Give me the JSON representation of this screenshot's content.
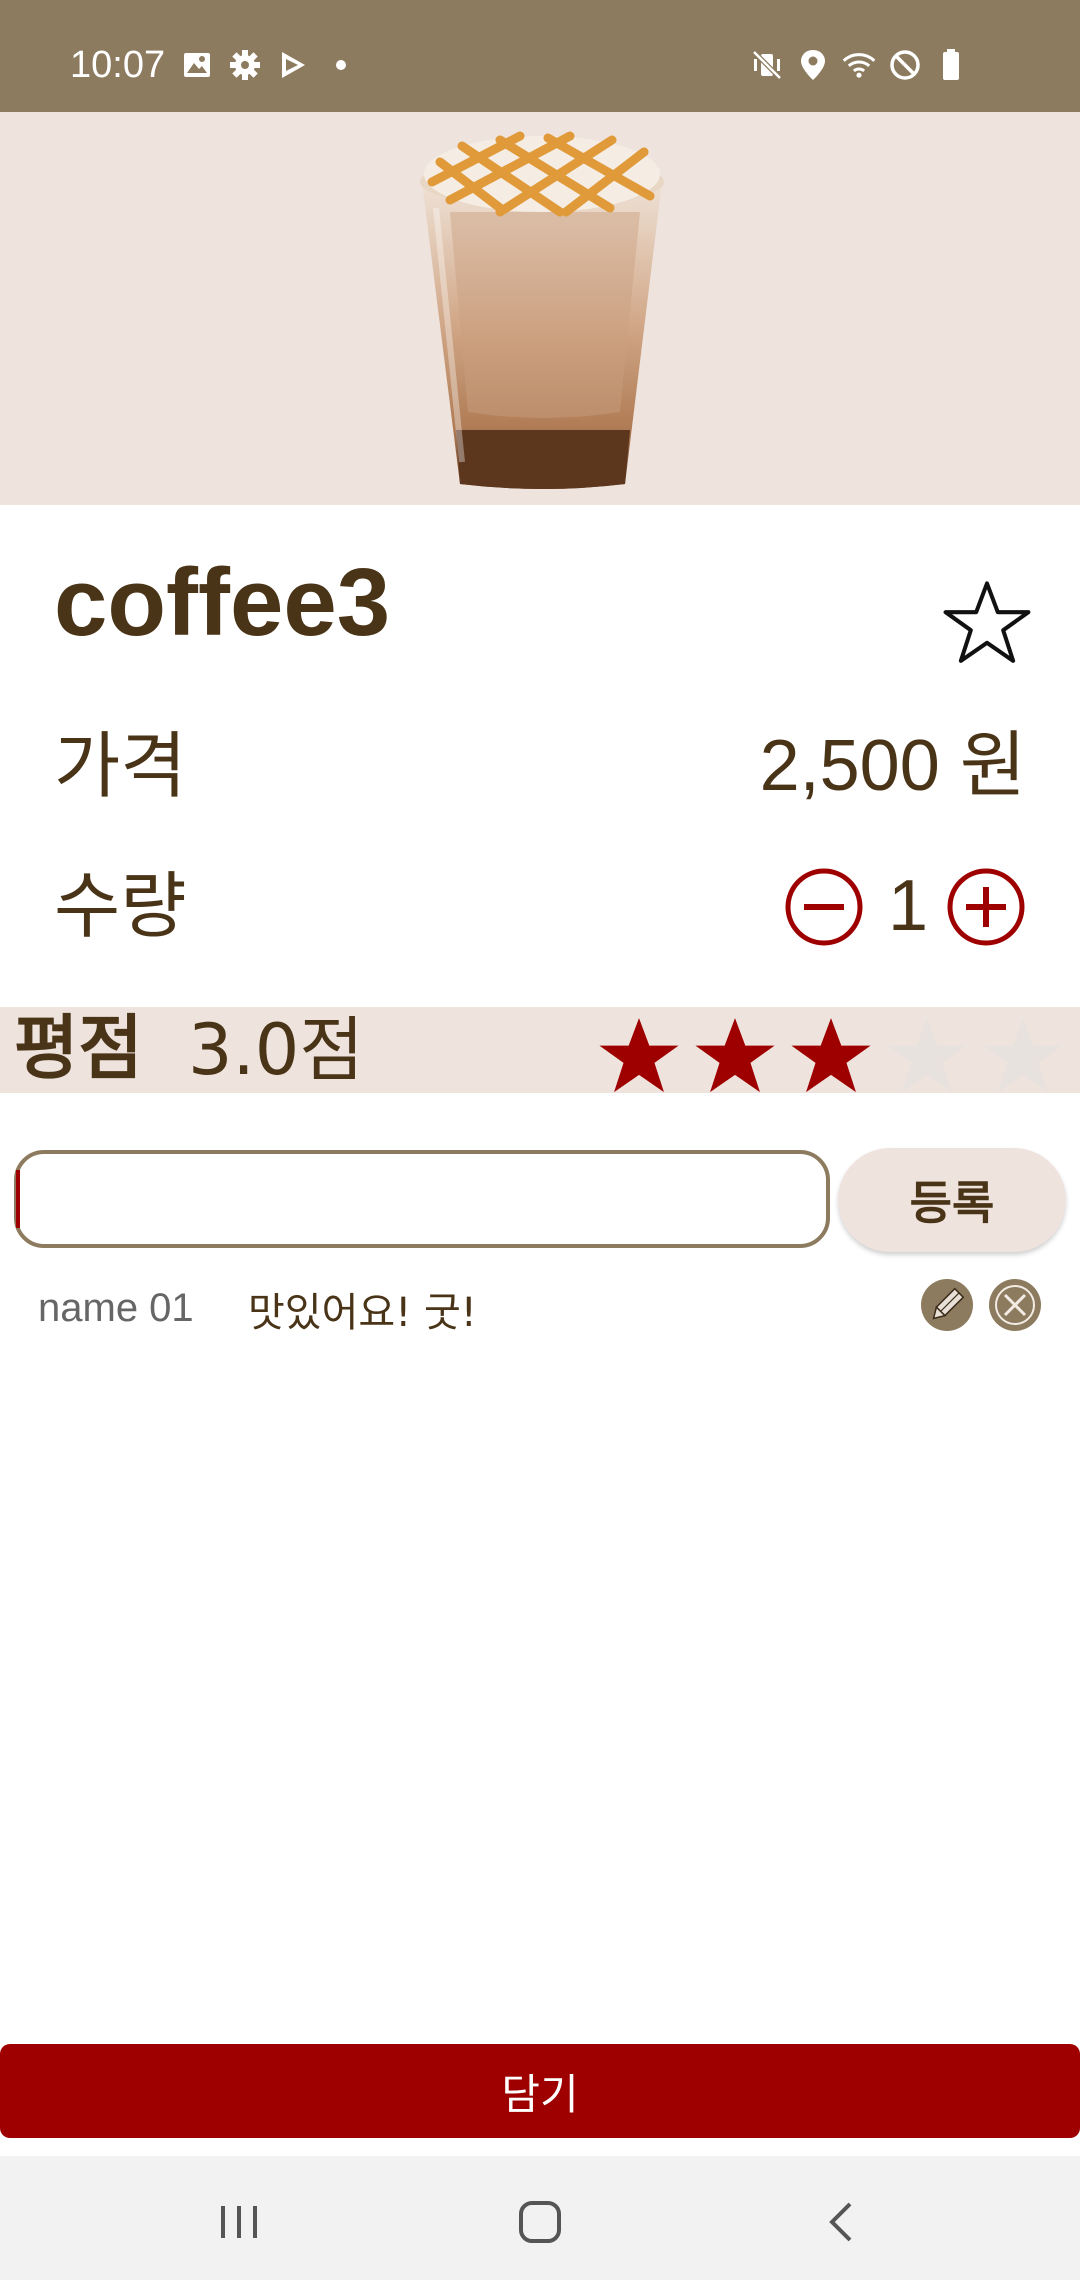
{
  "status_bar": {
    "time": "10:07",
    "left_icons": [
      "image-icon",
      "gear-icon",
      "play-store-icon",
      "dot-icon"
    ],
    "right_icons": [
      "mute-vibrate-icon",
      "location-icon",
      "wifi-icon",
      "do-not-disturb-icon",
      "battery-icon"
    ]
  },
  "product": {
    "name": "coffee3",
    "favorite": false,
    "price_label": "가격",
    "price_value": "2,500 원",
    "quantity_label": "수량",
    "quantity": "1"
  },
  "rating": {
    "label": "평점",
    "score_text": "3.0점",
    "value": 3,
    "max": 5,
    "filled_color": "#9e0000",
    "empty_color": "#e8e2de"
  },
  "comment_form": {
    "input_value": "",
    "submit_label": "등록"
  },
  "comments": [
    {
      "name": "name 01",
      "text": "맛있어요! 굿!"
    }
  ],
  "cart_button": {
    "label": "담기"
  },
  "nav_bar": {
    "items": [
      "recent-apps-icon",
      "home-icon",
      "back-icon"
    ]
  },
  "colors": {
    "status_bar": "#8d7b5f",
    "accent_red": "#9e0000",
    "beige": "#eee3dd",
    "text_brown": "#4a3418"
  }
}
